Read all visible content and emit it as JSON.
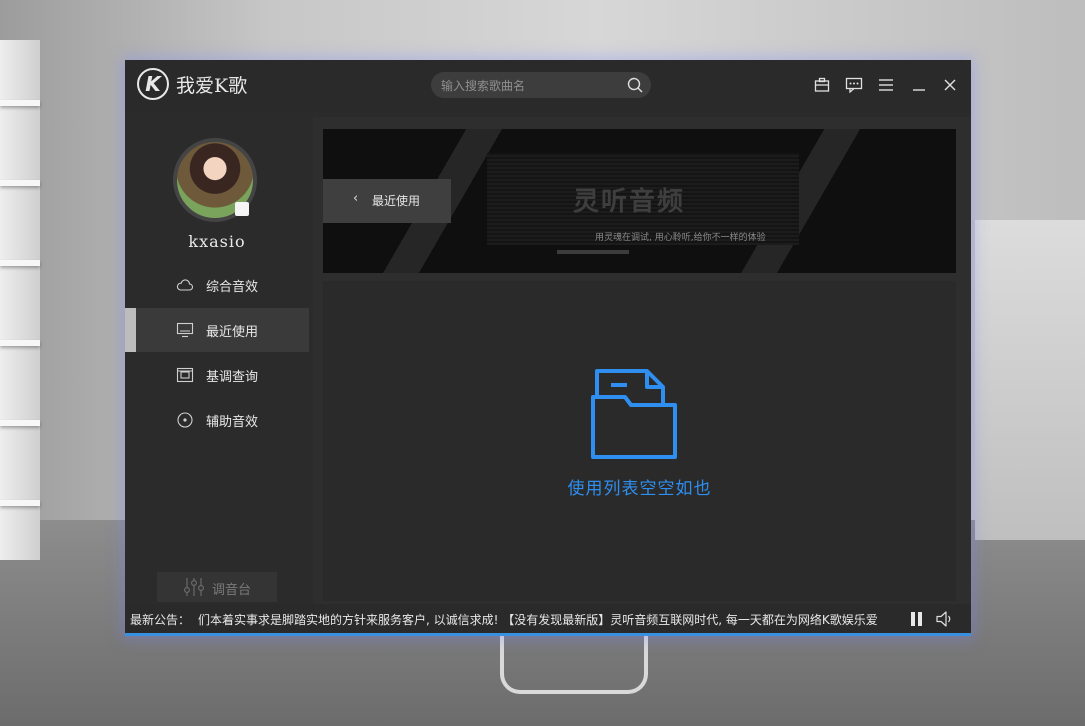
{
  "app": {
    "title": "我爱K歌",
    "logo_text": "K"
  },
  "search": {
    "placeholder": "输入搜索歌曲名"
  },
  "titlebar_icons": [
    "skin-icon",
    "message-icon",
    "menu-icon",
    "minimize-icon",
    "close-icon"
  ],
  "user": {
    "name": "kxasio"
  },
  "sidebar": {
    "items": [
      {
        "label": "综合音效",
        "icon": "cloud-icon",
        "active": false
      },
      {
        "label": "最近使用",
        "icon": "monitor-icon",
        "active": true
      },
      {
        "label": "基调查询",
        "icon": "frame-icon",
        "active": false
      },
      {
        "label": "辅助音效",
        "icon": "disc-icon",
        "active": false
      }
    ],
    "mixer_label": "调音台"
  },
  "banner": {
    "back_label": "最近使用",
    "title": "灵听音频",
    "subtitle": "用灵魂在调试, 用心聆听,给你不一样的体验"
  },
  "empty_state": {
    "text": "使用列表空空如也",
    "color": "#2e8ff0"
  },
  "status": {
    "label": "最新公告：",
    "text": "们本着实事求是脚踏实地的方针来服务客户, 以诚信求成! 【没有发现最新版】灵听音频互联网时代, 每一天都在为网络K歌娱乐爱"
  },
  "colors": {
    "accent": "#3790e0",
    "window_bg": "#2b2b2b"
  }
}
